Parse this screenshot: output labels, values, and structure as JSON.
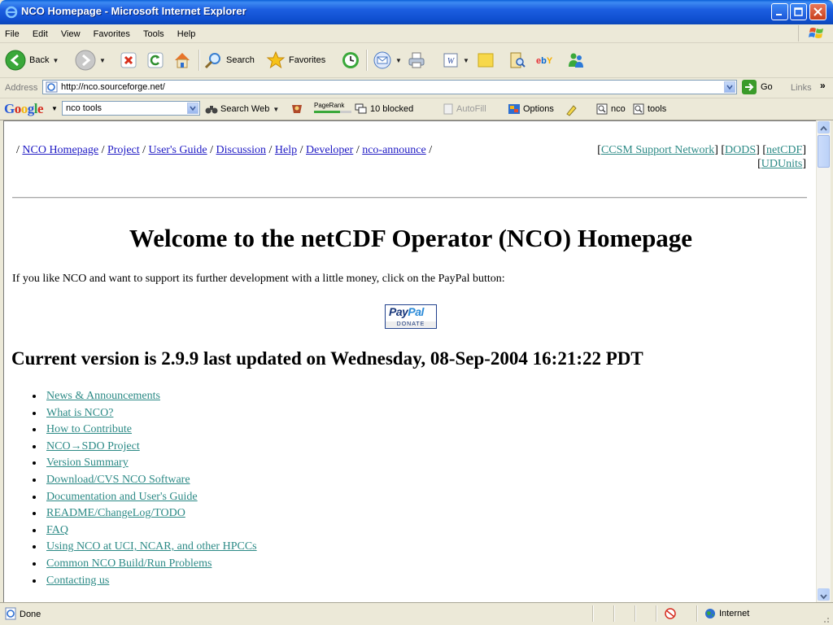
{
  "window": {
    "title": "NCO Homepage - Microsoft Internet Explorer"
  },
  "menu": [
    "File",
    "Edit",
    "View",
    "Favorites",
    "Tools",
    "Help"
  ],
  "toolbar": {
    "back": "Back",
    "search": "Search",
    "favorites": "Favorites"
  },
  "address": {
    "label": "Address",
    "url": "http://nco.sourceforge.net/",
    "go": "Go",
    "links": "Links"
  },
  "google": {
    "query": "nco tools",
    "search_web": "Search Web",
    "pagerank": "PageRank",
    "blocked": "10 blocked",
    "autofill": "AutoFill",
    "options": "Options",
    "chip1": "nco",
    "chip2": "tools"
  },
  "nav": {
    "left": [
      "NCO Homepage",
      "Project",
      "User's Guide",
      "Discussion",
      "Help",
      "Developer",
      "nco-announce"
    ],
    "right": [
      "CCSM Support Network",
      "DODS",
      "netCDF",
      "UDUnits"
    ]
  },
  "content": {
    "heading": "Welcome to the netCDF Operator (NCO) Homepage",
    "intro": "If you like NCO and want to support its further development with a little money, click on the PayPal button:",
    "paypal_brand_1": "Pay",
    "paypal_brand_2": "Pal",
    "paypal_donate": "DONATE",
    "version": "Current version is 2.9.9 last updated on Wednesday, 08-Sep-2004 16:21:22 PDT",
    "links": [
      "News & Announcements",
      "What is NCO?",
      "How to Contribute",
      "NCO→SDO Project",
      "Version Summary",
      "Download/CVS NCO Software",
      "Documentation and User's Guide",
      "README/ChangeLog/TODO",
      "FAQ",
      "Using NCO at UCI, NCAR, and other HPCCs",
      "Common NCO Build/Run Problems",
      "Contacting us"
    ]
  },
  "status": {
    "text": "Done",
    "zone": "Internet"
  }
}
